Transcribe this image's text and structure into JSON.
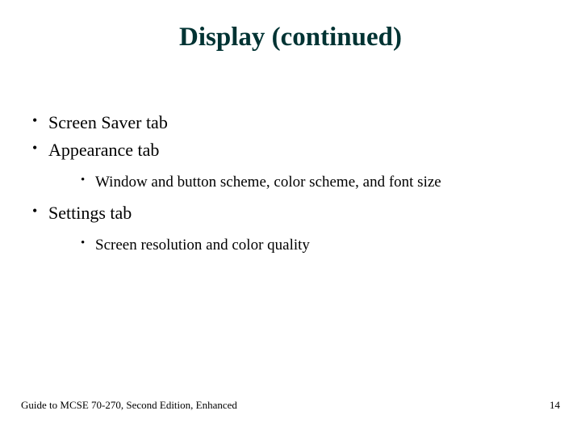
{
  "title": "Display (continued)",
  "bullets": {
    "item0": "Screen Saver tab",
    "item1": "Appearance tab",
    "item1_sub0": "Window and button scheme, color scheme, and font size",
    "item2": "Settings tab",
    "item2_sub0": "Screen resolution and color quality"
  },
  "footer": {
    "left": "Guide to MCSE 70-270, Second Edition, Enhanced",
    "right": "14"
  }
}
